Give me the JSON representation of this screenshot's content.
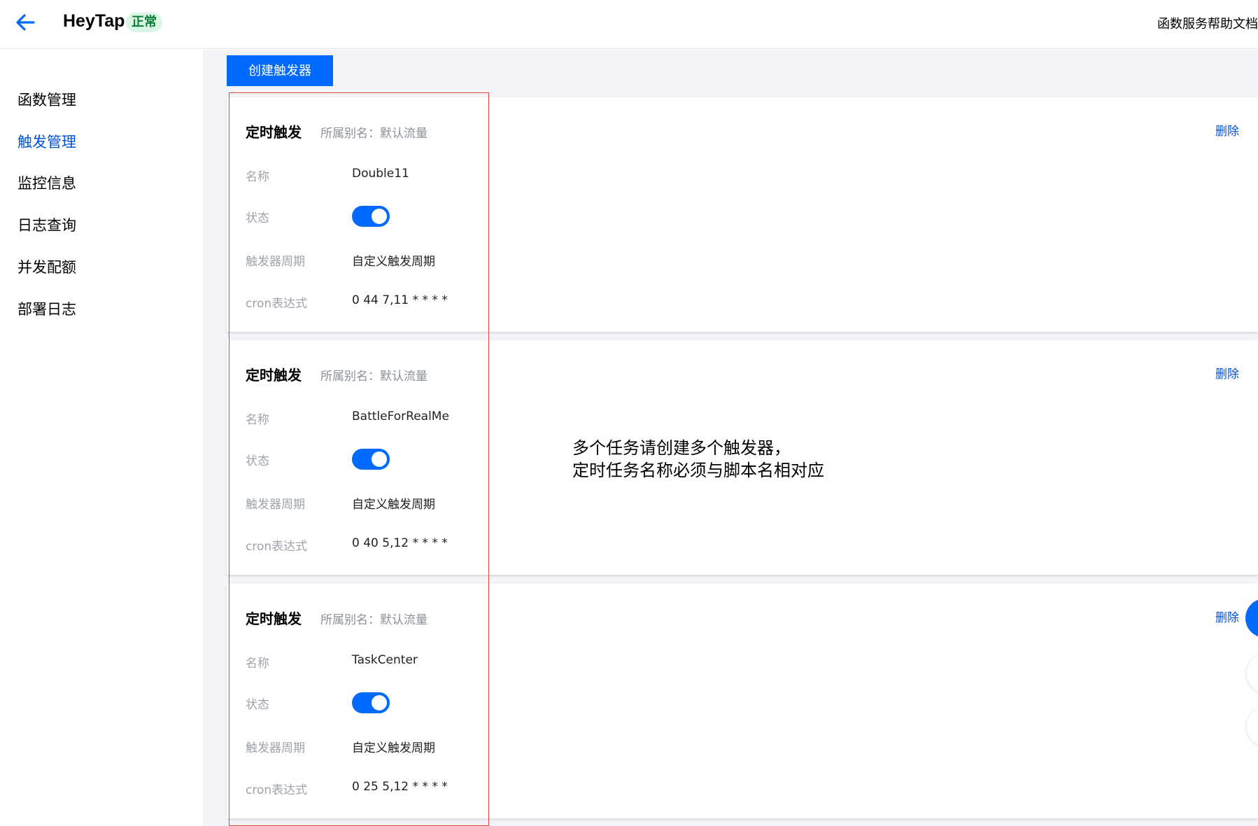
{
  "header": {
    "app_title": "HeyTap",
    "status": "正常",
    "help_link": "函数服务帮助文档"
  },
  "sidebar": {
    "items": [
      {
        "label": "函数管理",
        "active": false
      },
      {
        "label": "触发管理",
        "active": true
      },
      {
        "label": "监控信息",
        "active": false
      },
      {
        "label": "日志查询",
        "active": false
      },
      {
        "label": "并发配额",
        "active": false
      },
      {
        "label": "部署日志",
        "active": false
      }
    ]
  },
  "main": {
    "create_button": "创建触发器",
    "labels": {
      "name": "名称",
      "status": "状态",
      "period": "触发器周期",
      "cron": "cron表达式"
    },
    "triggers": [
      {
        "title": "定时触发",
        "alias": "所属别名：默认流量",
        "delete": "删除",
        "name": "Double11",
        "enabled": true,
        "period": "自定义触发周期",
        "cron": "0 44 7,11 * * * *"
      },
      {
        "title": "定时触发",
        "alias": "所属别名：默认流量",
        "delete": "删除",
        "name": "BattleForRealMe",
        "enabled": true,
        "period": "自定义触发周期",
        "cron": "0 40 5,12 * * * *"
      },
      {
        "title": "定时触发",
        "alias": "所属别名：默认流量",
        "delete": "删除",
        "name": "TaskCenter",
        "enabled": true,
        "period": "自定义触发周期",
        "cron": "0 25 5,12 * * * *"
      }
    ]
  },
  "annotation": {
    "line1": "多个任务请创建多个触发器，",
    "line2": "定时任务名称必须与脚本名相对应"
  },
  "colors": {
    "primary": "#0069ff",
    "active_nav": "#0052d9",
    "status_badge_bg": "#d9f5e3",
    "status_badge_text": "#0a7d35",
    "annotation_border": "#e0453a"
  }
}
